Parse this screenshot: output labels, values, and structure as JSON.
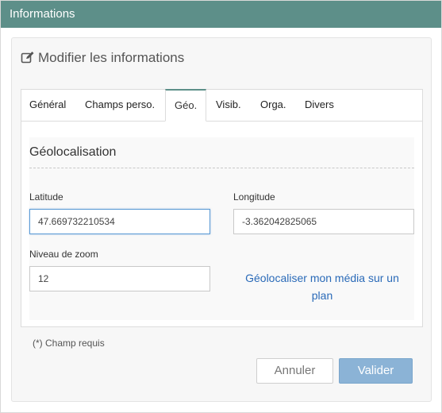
{
  "window": {
    "title": "Informations"
  },
  "panel": {
    "title": "Modifier les informations",
    "icon": "edit-icon"
  },
  "tabs": [
    {
      "label": "Général"
    },
    {
      "label": "Champs perso."
    },
    {
      "label": "Géo.",
      "active": true
    },
    {
      "label": "Visib."
    },
    {
      "label": "Orga."
    },
    {
      "label": "Divers"
    }
  ],
  "geo": {
    "section_title": "Géolocalisation",
    "latitude": {
      "label": "Latitude",
      "value": "47.669732210534"
    },
    "longitude": {
      "label": "Longitude",
      "value": "-3.362042825065"
    },
    "zoom": {
      "label": "Niveau de zoom",
      "value": "12"
    },
    "link": "Géolocaliser mon média sur un plan"
  },
  "footer": {
    "required_note": "(*) Champ requis",
    "cancel_label": "Annuler",
    "submit_label": "Valider"
  },
  "colors": {
    "titlebar": "#5d8f89",
    "link": "#2a6ab8",
    "primary_button": "#8bb3d6"
  }
}
